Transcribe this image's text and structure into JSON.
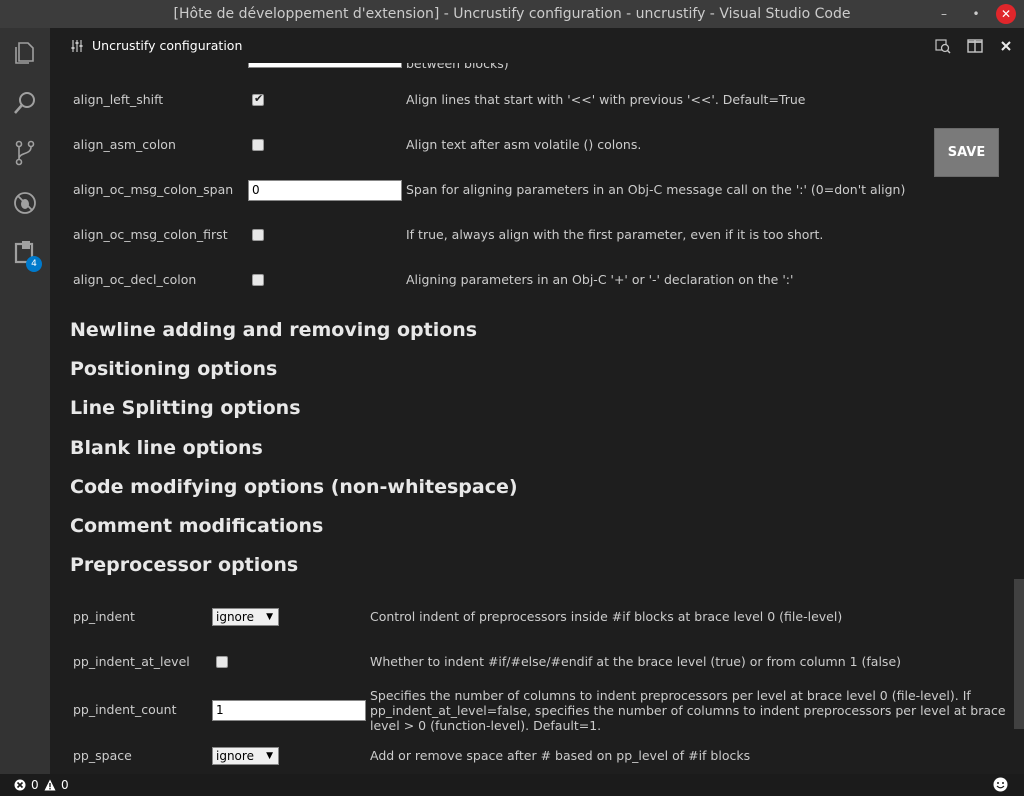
{
  "window": {
    "title": "[Hôte de développement d'extension] - Uncrustify configuration - uncrustify - Visual Studio Code",
    "minimize_glyph": "–",
    "maximize_glyph": "•",
    "close_glyph": "✕"
  },
  "activity_bar": {
    "items": [
      {
        "icon": "files-icon"
      },
      {
        "icon": "search-icon"
      },
      {
        "icon": "source-control-icon"
      },
      {
        "icon": "debug-icon"
      },
      {
        "icon": "extensions-icon",
        "badge": "4"
      }
    ]
  },
  "tab": {
    "icon": "settings-sliders-icon",
    "label": "Uncrustify configuration"
  },
  "toolbar": {
    "save_label": "SAVE"
  },
  "partial_text": "between blocks)",
  "align_options": [
    {
      "name": "align_left_shift",
      "type": "checkbox",
      "checked": true,
      "description": "Align lines that start with '<<' with previous '<<'. Default=True"
    },
    {
      "name": "align_asm_colon",
      "type": "checkbox",
      "checked": false,
      "description": "Align text after asm volatile () colons."
    },
    {
      "name": "align_oc_msg_colon_span",
      "type": "text",
      "value": "0",
      "description": "Span for aligning parameters in an Obj-C message call on the ':' (0=don't align)"
    },
    {
      "name": "align_oc_msg_colon_first",
      "type": "checkbox",
      "checked": false,
      "description": "If true, always align with the first parameter, even if it is too short."
    },
    {
      "name": "align_oc_decl_colon",
      "type": "checkbox",
      "checked": false,
      "description": "Aligning parameters in an Obj-C '+' or '-' declaration on the ':'"
    }
  ],
  "sections": [
    "Newline adding and removing options",
    "Positioning options",
    "Line Splitting options",
    "Blank line options",
    "Code modifying options (non-whitespace)",
    "Comment modifications",
    "Preprocessor options"
  ],
  "pp_options": [
    {
      "name": "pp_indent",
      "type": "select",
      "value": "ignore",
      "description": "Control indent of preprocessors inside #if blocks at brace level 0 (file-level)"
    },
    {
      "name": "pp_indent_at_level",
      "type": "checkbox",
      "checked": false,
      "description": "Whether to indent #if/#else/#endif at the brace level (true) or from column 1 (false)"
    },
    {
      "name": "pp_indent_count",
      "type": "text",
      "value": "1",
      "description": "Specifies the number of columns to indent preprocessors per level at brace level 0 (file-level). If pp_indent_at_level=false, specifies the number of columns to indent preprocessors per level at brace level > 0 (function-level). Default=1."
    },
    {
      "name": "pp_space",
      "type": "select",
      "value": "ignore",
      "description": "Add or remove space after # based on pp_level of #if blocks"
    }
  ],
  "status_bar": {
    "errors": "0",
    "warnings": "0"
  },
  "colors": {
    "editor_bg": "#1e1e1e",
    "activity_bar_bg": "#333333",
    "title_bar_bg": "#3c3c3c",
    "badge": "#007acc",
    "save_button": "#7a7a7a",
    "close_button": "#e0262b"
  }
}
